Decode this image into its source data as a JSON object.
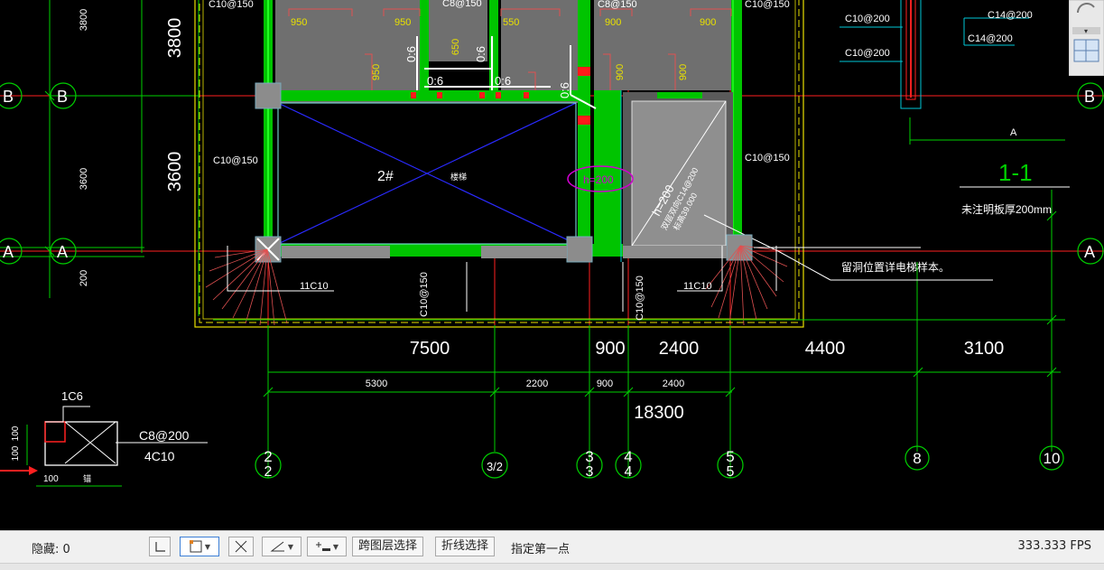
{
  "drawing": {
    "grid_rows": [
      {
        "id": "row-b",
        "label": "B"
      },
      {
        "id": "row-a",
        "label": "A"
      }
    ],
    "grid_columns": [
      {
        "id": "col-2",
        "label": "2"
      },
      {
        "id": "col-2-2",
        "label": "3/2"
      },
      {
        "id": "col-3",
        "label": "3"
      },
      {
        "id": "col-4",
        "label": "4"
      },
      {
        "id": "col-5",
        "label": "5"
      },
      {
        "id": "col-8",
        "label": "8"
      },
      {
        "id": "col-10",
        "label": "10"
      }
    ],
    "col_subscripts": {
      "col2": "2",
      "col3": "3",
      "col4": "4",
      "col5": "5"
    },
    "row_dims": {
      "top": "3800",
      "mid": "3600",
      "small_top": "3800",
      "small_mid": "3600",
      "small_bottom": "200"
    },
    "dims_large": {
      "d1": "7500",
      "d2": "900",
      "d3": "2400",
      "d4": "4400",
      "d5": "3100",
      "total": "18300"
    },
    "dims_small": {
      "d1": "5300",
      "d2": "2200",
      "d3": "900",
      "d4": "2400"
    },
    "rebar_labels": {
      "c10_150_a": "C10@150",
      "c10_150_b": "C10@150",
      "c10_150_c": "C10@150",
      "c10_150_d": "C10@150",
      "c10_150_e": "C10@150",
      "c10_150_f": "C10@150",
      "c8_150_a": "C8@150",
      "c8_150_b": "C8@150",
      "c10_200_a": "C10@200",
      "c10_200_b": "C10@200",
      "c14_200_a": "C14@200",
      "c14_200_b": "C14@200",
      "c8_200": "C8@200",
      "c4_10": "4C10",
      "c11_10_a": "11C10",
      "c11_10_b": "11C10",
      "c1_6": "1C6"
    },
    "slab_dims": {
      "s950a": "950",
      "s950b": "950",
      "s650": "650",
      "s550": "550",
      "s900a": "900",
      "s900b": "900",
      "s950c": "950",
      "s900c": "900",
      "s900d": "900",
      "s0_6a": "0:6",
      "s0_6b": "0:6",
      "s0_6c": "0:6",
      "s0_6d": "0:6",
      "s0_6e": "0:6"
    },
    "room_label": "2#",
    "room_label_b": "楼梯",
    "elev_tag": "h=200",
    "diag_text": {
      "h": "h=200",
      "reinforce": "双层双向C14@200",
      "elev": "标高39.000"
    },
    "section_title": "1-1",
    "section_note": "未注明板厚200mm",
    "section_small_a": "A",
    "leader_note": "留洞位置详电梯样本。",
    "detail_dims": {
      "d100a": "100",
      "d100b": "100",
      "d100c": "100",
      "lbl": "锚"
    }
  },
  "statusbar": {
    "hidden_label": "隐藏: 0",
    "cross_layer_btn": "跨图层选择",
    "polyline_btn": "折线选择",
    "prompt": "指定第一点",
    "fps": "333.333 FPS"
  },
  "colors": {
    "grid_line": "#ff2020",
    "wall_green": "#00c400",
    "wall_bright": "#22ff22",
    "column_gray": "#8c8c8c",
    "dim_green": "#00d000",
    "yellow": "#e8e000",
    "magenta": "#d000d0",
    "blue_diag": "#2a2aff",
    "cyan": "#00c8d8"
  }
}
